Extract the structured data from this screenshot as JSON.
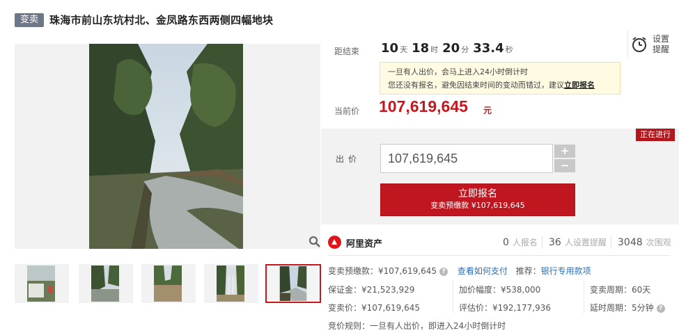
{
  "header": {
    "badge": "变卖",
    "title": "珠海市前山东坑村北、金凤路东西两侧四幅地块"
  },
  "countdown": {
    "label": "距结束",
    "days": "10",
    "days_unit": "天",
    "hours": "18",
    "hours_unit": "时",
    "minutes": "20",
    "minutes_unit": "分",
    "seconds": "33.4",
    "seconds_unit": "秒"
  },
  "remind": {
    "label": "设置提醒",
    "icon": "alarm-clock-icon"
  },
  "notice": {
    "line1": "一旦有人出价，会马上进入24小时倒计时",
    "line2_prefix": "您还没有报名，避免因结束时间的变动而错过，建议",
    "line2_link": "立即报名"
  },
  "price": {
    "label": "当前价",
    "value": "107,619,645",
    "unit": "元"
  },
  "bid": {
    "status": "正在进行",
    "label": "出价",
    "input_value": "107,619,645",
    "plus": "+",
    "minus": "−",
    "apply_label": "立即报名",
    "apply_sub": "变卖预缴款 ¥107,619,645"
  },
  "platform": {
    "name": "阿里资产",
    "registered_count": "0",
    "registered_label": "人报名",
    "reminder_count": "36",
    "reminder_label": "人设置提醒",
    "views_count": "3048",
    "views_label": "次围观"
  },
  "details": {
    "deposit_label": "变卖预缴款：¥107,619,645",
    "howto_link": "查看如何支付",
    "recommend_label": "推荐：",
    "recommend_link": "银行专用款项",
    "margin": "保证金：¥21,523,929",
    "increment": "加价幅度：¥538,000",
    "period": "变卖周期：60天",
    "sale_price": "变卖价：¥107,619,645",
    "appraisal": "评估价：¥192,177,936",
    "extension": "延时周期：5分钟",
    "rule": "竞价规则：一旦有人出价，即进入24小时倒计时"
  },
  "colors": {
    "accent": "#c8161d",
    "badge": "#6e7787",
    "link": "#2d6fb7",
    "notice_bg": "#fffbe3"
  }
}
